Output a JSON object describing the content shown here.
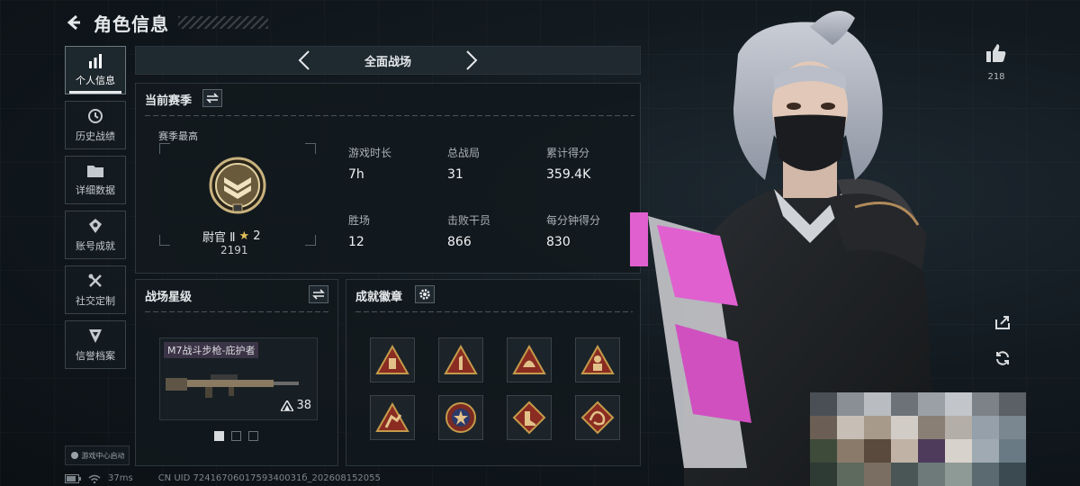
{
  "header": {
    "title": "角色信息"
  },
  "sidebar": {
    "items": [
      {
        "label": "个人信息",
        "icon": "bar-chart-icon",
        "active": true
      },
      {
        "label": "历史战绩",
        "icon": "history-clock-icon",
        "active": false
      },
      {
        "label": "详细数据",
        "icon": "folder-icon",
        "active": false
      },
      {
        "label": "账号成就",
        "icon": "achievement-icon",
        "active": false
      },
      {
        "label": "社交定制",
        "icon": "tools-icon",
        "active": false
      },
      {
        "label": "信誉档案",
        "icon": "credit-shield-icon",
        "active": false
      }
    ],
    "launcher_label": "游戏中心启动"
  },
  "mode_bar": {
    "label": "全面战场"
  },
  "season": {
    "title": "当前赛季",
    "peak_label": "赛季最高",
    "rank_name": "尉官 Ⅱ",
    "rank_stars": "2",
    "rank_points": "2191",
    "stats": [
      {
        "label": "游戏时长",
        "value": "7h"
      },
      {
        "label": "总战局",
        "value": "31"
      },
      {
        "label": "累计得分",
        "value": "359.4K"
      },
      {
        "label": "胜场",
        "value": "12"
      },
      {
        "label": "击败干员",
        "value": "866"
      },
      {
        "label": "每分钟得分",
        "value": "830"
      }
    ]
  },
  "battlefield_level": {
    "title": "战场星级",
    "weapon_name": "M7战斗步枪-庇护者",
    "weapon_level": "38"
  },
  "badges": {
    "title": "成就徽章",
    "items": [
      "badge-bottle-icon",
      "badge-number-one-icon",
      "badge-helmet-icon",
      "badge-soldier-icon",
      "badge-runner-icon",
      "badge-star-emblem-icon",
      "badge-boot-icon",
      "badge-dragon-icon"
    ]
  },
  "status": {
    "ping": "37ms",
    "uid_text": "CN UID 7241670601759340031б_202608152055"
  },
  "right": {
    "like_count": "218"
  },
  "colors": {
    "accent": "#e6e9ec",
    "badge_gold": "#c49a4a",
    "badge_red": "#8a2c22",
    "weapon_pink": "#e060d0"
  }
}
